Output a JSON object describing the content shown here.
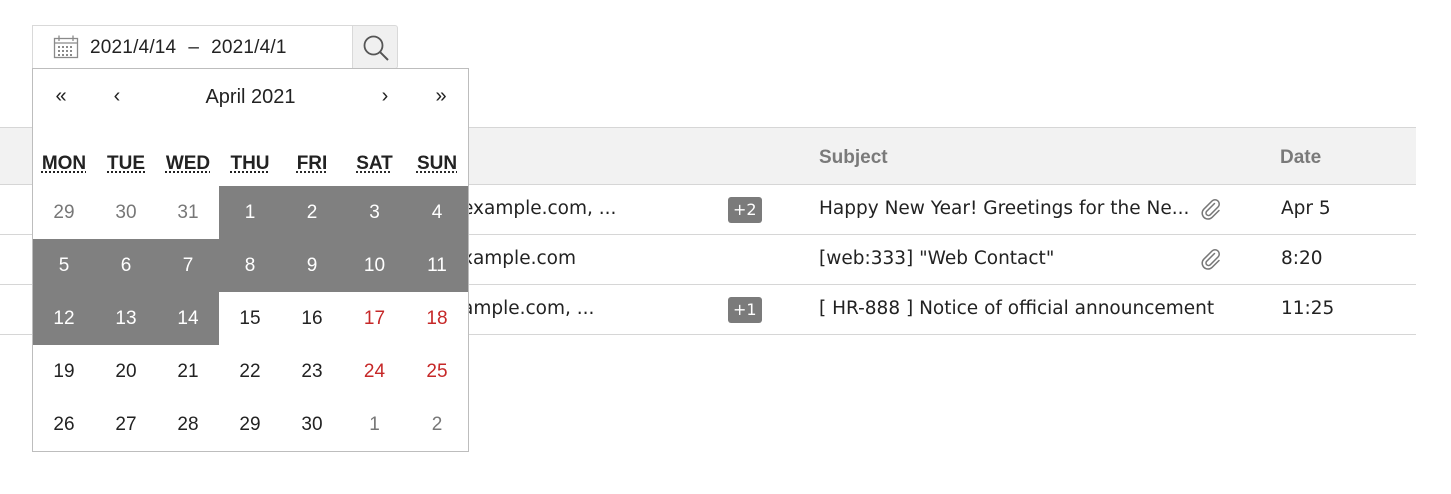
{
  "date_range": {
    "start": "2021/4/14",
    "separator": "–",
    "end": "2021/4/1"
  },
  "calendar": {
    "title": "April 2021",
    "nav": {
      "prev_year": "«",
      "prev_month": "‹",
      "next_month": "›",
      "next_year": "»"
    },
    "weekdays": [
      "MON",
      "TUE",
      "WED",
      "THU",
      "FRI",
      "SAT",
      "SUN"
    ],
    "weeks": [
      [
        "29",
        "30",
        "31",
        "1",
        "2",
        "3",
        "4"
      ],
      [
        "5",
        "6",
        "7",
        "8",
        "9",
        "10",
        "11"
      ],
      [
        "12",
        "13",
        "14",
        "15",
        "16",
        "17",
        "18"
      ],
      [
        "19",
        "20",
        "21",
        "22",
        "23",
        "24",
        "25"
      ],
      [
        "26",
        "27",
        "28",
        "29",
        "30",
        "1",
        "2"
      ]
    ],
    "selected_range_start": "1",
    "selected_range_end": "14",
    "colors": {
      "range_bg": "#808080",
      "weekend": "#c62828",
      "outside_month": "#777777"
    }
  },
  "table": {
    "headers": {
      "subject": "Subject",
      "date": "Date"
    },
    "rows": [
      {
        "to": "example.com, ...",
        "more": "+2",
        "subject": "Happy New Year! Greetings for the Ne...",
        "attachment": true,
        "date": "Apr 5"
      },
      {
        "to": "xample.com",
        "more": "",
        "subject": "[web:333] \"Web Contact\"",
        "attachment": true,
        "date": "8:20"
      },
      {
        "to": "ample.com, ...",
        "more": "+1",
        "subject": "[ HR-888 ] Notice of official announcement",
        "attachment": false,
        "date": "11:25"
      }
    ]
  }
}
